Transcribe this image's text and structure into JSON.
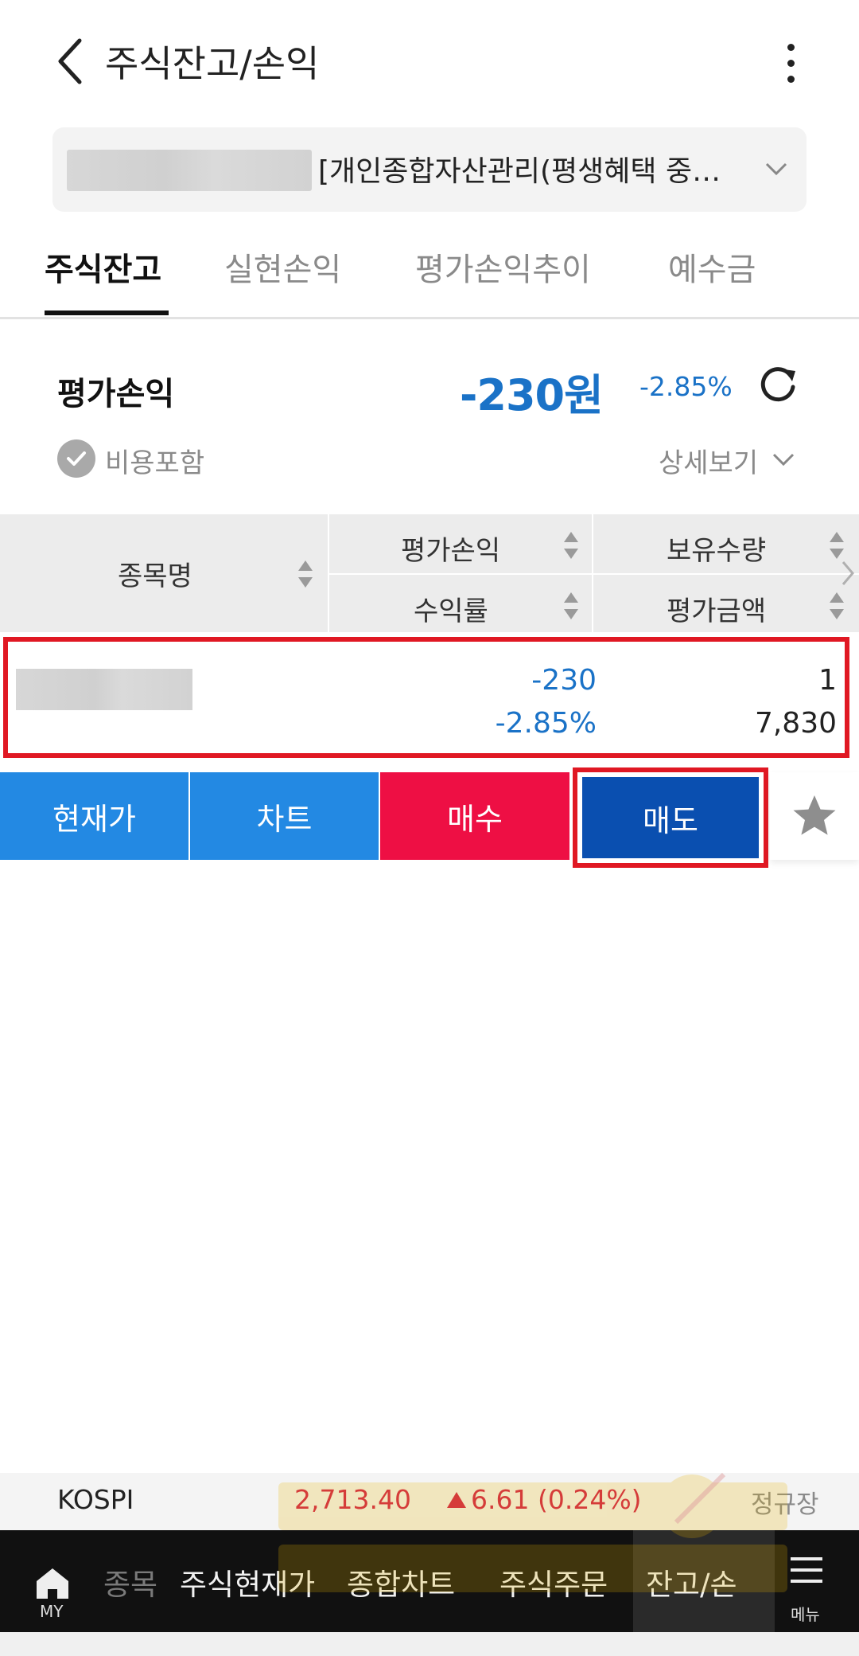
{
  "header": {
    "title": "주식잔고/손익"
  },
  "account": {
    "label": "[개인종합자산관리(평생혜택 중…"
  },
  "tabs": [
    {
      "label": "주식잔고",
      "active": true
    },
    {
      "label": "실현손익",
      "active": false
    },
    {
      "label": "평가손익추이",
      "active": false
    },
    {
      "label": "예수금",
      "active": false
    }
  ],
  "summary": {
    "label": "평가손익",
    "value": "-230원",
    "rate": "-2.85%",
    "include_cost_label": "비용포함",
    "detail_label": "상세보기"
  },
  "table": {
    "headers": {
      "name": "종목명",
      "eval_pl": "평가손익",
      "qty": "보유수량",
      "return_rate": "수익률",
      "eval_amount": "평가금액"
    },
    "rows": [
      {
        "eval_pl": "-230",
        "return_rate": "-2.85%",
        "qty": "1",
        "eval_amount": "7,830"
      }
    ]
  },
  "actions": {
    "current": "현재가",
    "chart": "차트",
    "buy": "매수",
    "sell": "매도"
  },
  "ticker": {
    "name": "KOSPI",
    "value": "2,713.40",
    "change": "6.61 (0.24%)",
    "session": "정규장"
  },
  "bottom_nav": {
    "home": "MY",
    "items": [
      "종목",
      "주식현재가",
      "종합차트",
      "주식주문",
      "잔고/손"
    ],
    "menu": "메뉴"
  },
  "colors": {
    "accent_blue": "#1a72c7",
    "buy_red": "#ee0f44",
    "sell_blue": "#0a4fb0",
    "highlight_red": "#e01823"
  }
}
